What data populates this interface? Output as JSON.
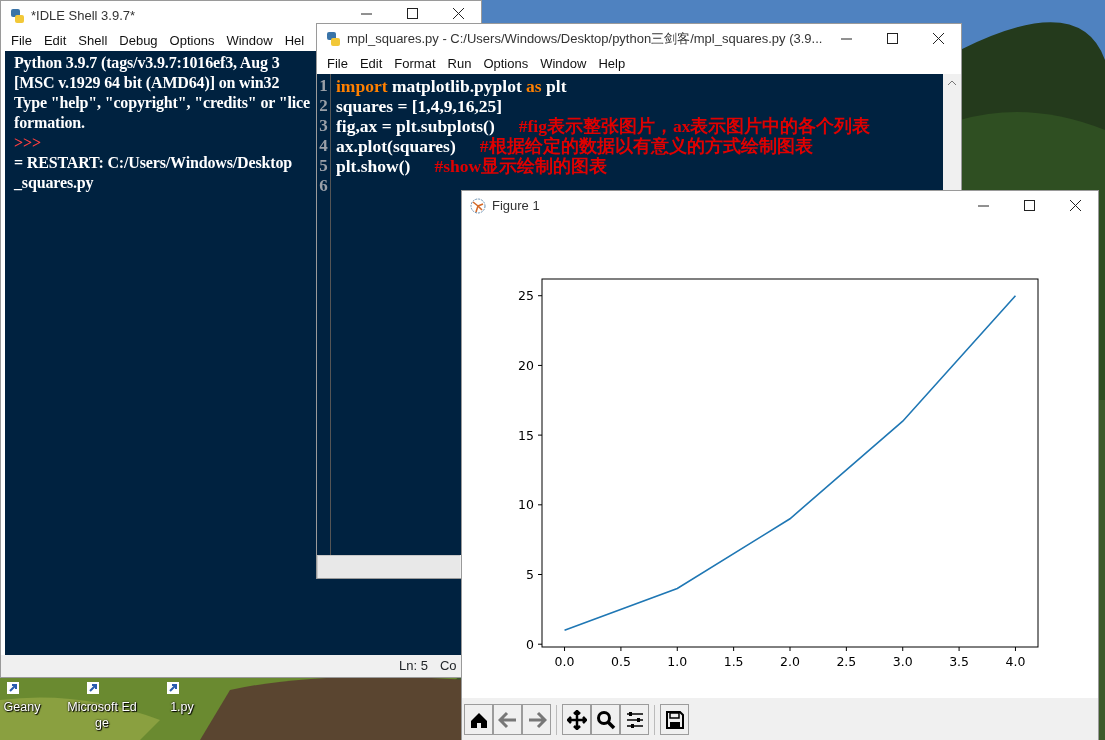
{
  "desktop_icons": [
    {
      "label": "Geany"
    },
    {
      "label": "Microsoft Edge"
    },
    {
      "label": "1.py"
    }
  ],
  "shell_window": {
    "title": "*IDLE Shell 3.9.7*",
    "menu": [
      "File",
      "Edit",
      "Shell",
      "Debug",
      "Options",
      "Window",
      "Hel"
    ],
    "lines": [
      {
        "kind": "output",
        "text": "Python 3.9.7 (tags/v3.9.7:1016ef3, Aug 3"
      },
      {
        "kind": "output",
        "text": "[MSC v.1929 64 bit (AMD64)] on win32"
      },
      {
        "kind": "output",
        "text": "Type \"help\", \"copyright\", \"credits\" or \"lice"
      },
      {
        "kind": "output",
        "text": "formation."
      },
      {
        "kind": "prompt",
        "text": ">>>"
      },
      {
        "kind": "output",
        "text": "= RESTART: C:/Users/Windows/Desktop"
      },
      {
        "kind": "output",
        "text": "_squares.py"
      }
    ],
    "status": [
      "Ln: 5",
      "Co"
    ]
  },
  "editor_window": {
    "title": "mpl_squares.py - C:/Users/Windows/Desktop/python三剑客/mpl_squares.py (3.9...",
    "menu": [
      "File",
      "Edit",
      "Format",
      "Run",
      "Options",
      "Window",
      "Help"
    ],
    "lines": [
      {
        "number": "1",
        "code": [
          {
            "kind": "keyword",
            "text": "import"
          },
          {
            "kind": "plain",
            "text": " matplotlib.pyplot "
          },
          {
            "kind": "keyword",
            "text": "as"
          },
          {
            "kind": "plain",
            "text": " plt"
          }
        ]
      },
      {
        "number": "2",
        "code": [
          {
            "kind": "plain",
            "text": "squares = [1,4,9,16,25]"
          }
        ]
      },
      {
        "number": "3",
        "code": [
          {
            "kind": "plain",
            "text": "fig,ax = plt.subplots()"
          }
        ],
        "comment": "#fig表示整张图片，ax表示图片中的各个列表"
      },
      {
        "number": "4",
        "code": [
          {
            "kind": "plain",
            "text": "ax.plot(squares)"
          }
        ],
        "comment": "#根据给定的数据以有意义的方式绘制图表"
      },
      {
        "number": "5",
        "code": [
          {
            "kind": "plain",
            "text": "plt.show()"
          }
        ],
        "comment": "#show显示绘制的图表"
      },
      {
        "number": "6"
      }
    ]
  },
  "figure_window": {
    "title": "Figure 1",
    "chart_data": {
      "type": "line",
      "x": [
        0,
        1,
        2,
        3,
        4
      ],
      "series": [
        {
          "color": "#1f77b4",
          "values": [
            1,
            4,
            9,
            16,
            25
          ]
        }
      ],
      "xlim": [
        -0.2,
        4.2
      ],
      "ylim": [
        -0.2,
        26.2
      ],
      "xticks": [
        {
          "value": 0,
          "label": "0.0"
        },
        {
          "value": 0.5,
          "label": "0.5"
        },
        {
          "value": 1,
          "label": "1.0"
        },
        {
          "value": 1.5,
          "label": "1.5"
        },
        {
          "value": 2,
          "label": "2.0"
        },
        {
          "value": 2.5,
          "label": "2.5"
        },
        {
          "value": 3,
          "label": "3.0"
        },
        {
          "value": 3.5,
          "label": "3.5"
        },
        {
          "value": 4,
          "label": "4.0"
        }
      ],
      "yticks": [
        0,
        5,
        10,
        15,
        20,
        25
      ]
    }
  }
}
